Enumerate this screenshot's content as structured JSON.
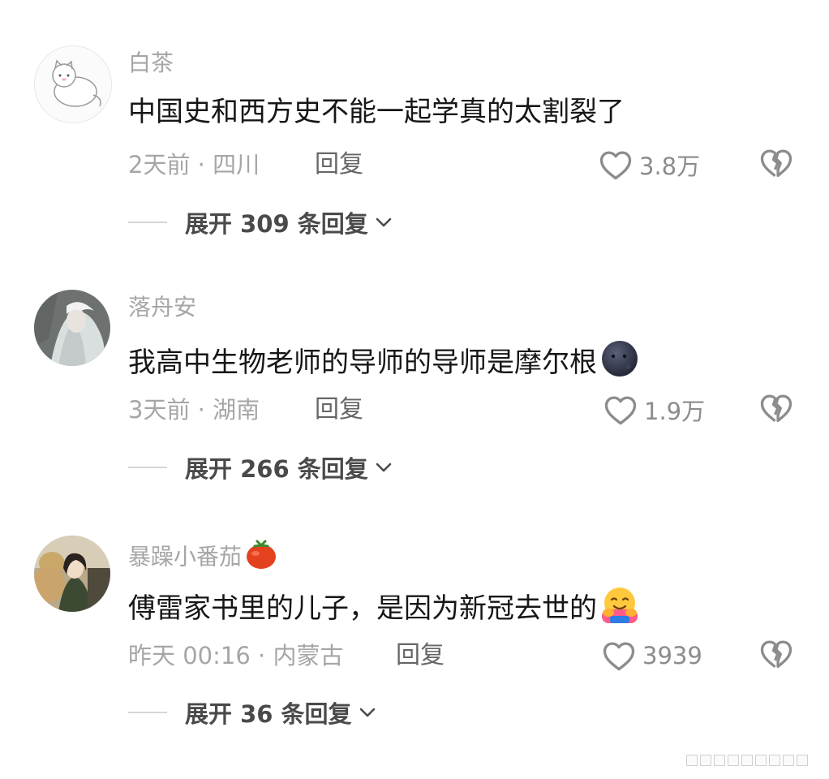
{
  "comments": [
    {
      "username": "白茶",
      "text": "中国史和西方史不能一起学真的太割裂了",
      "meta": "2天前 · 四川",
      "reply_label": "回复",
      "likes": "3.8万",
      "expand_label": "展开 309 条回复"
    },
    {
      "username": "落舟安",
      "text": "我高中生物老师的导师的导师是摩尔根",
      "meta": "3天前 · 湖南",
      "reply_label": "回复",
      "likes": "1.9万",
      "expand_label": "展开 266 条回复"
    },
    {
      "username": "暴躁小番茄",
      "text": "傅雷家书里的儿子，是因为新冠去世的",
      "meta": "昨天 00:16 · 内蒙古",
      "reply_label": "回复",
      "likes": "3939",
      "expand_label": "展开 36 条回复"
    }
  ],
  "icons": {
    "like": "heart-outline-icon",
    "dislike": "broken-heart-icon",
    "expand": "chevron-down-icon",
    "emoji_1": "new-moon-face-emoji",
    "emoji_2": "tomato-emoji",
    "emoji_3": "hugging-face-emoji"
  },
  "colors": {
    "username": "#a6a6a6",
    "text": "#161616",
    "meta": "#a6a6a6",
    "expand": "#4a4a4a"
  }
}
